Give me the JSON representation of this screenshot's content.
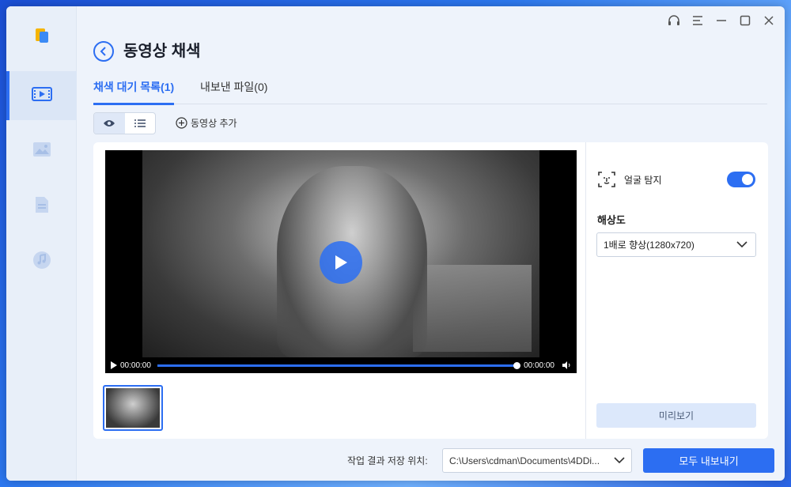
{
  "titlebar": {
    "icons": [
      "headset-icon",
      "menu-icon",
      "minimize-icon",
      "maximize-icon",
      "close-icon"
    ]
  },
  "sidebar": {
    "items": [
      {
        "icon": "video-enhance-icon",
        "active": true
      },
      {
        "icon": "image-icon",
        "active": false
      },
      {
        "icon": "document-icon",
        "active": false
      },
      {
        "icon": "music-icon",
        "active": false
      }
    ]
  },
  "header": {
    "title": "동영상 채색"
  },
  "tabs": [
    {
      "label": "채색 대기 목록(1)",
      "active": true
    },
    {
      "label": "내보낸 파일(0)",
      "active": false
    }
  ],
  "toolbar": {
    "add_video_label": "동영상 추가"
  },
  "player": {
    "current_time": "00:00:00",
    "duration": "00:00:00",
    "progress": 1.0
  },
  "settings": {
    "face_detect_label": "얼굴 탐지",
    "face_detect_on": true,
    "resolution_label": "해상도",
    "resolution_value": "1배로 향상(1280x720)",
    "preview_label": "미리보기"
  },
  "footer": {
    "save_location_label": "작업 결과 저장 위치:",
    "save_path": "C:\\Users\\cdman\\Documents\\4DDi...",
    "export_all_label": "모두 내보내기"
  },
  "colors": {
    "accent": "#2c6ef2",
    "bg": "#eef3fb"
  }
}
